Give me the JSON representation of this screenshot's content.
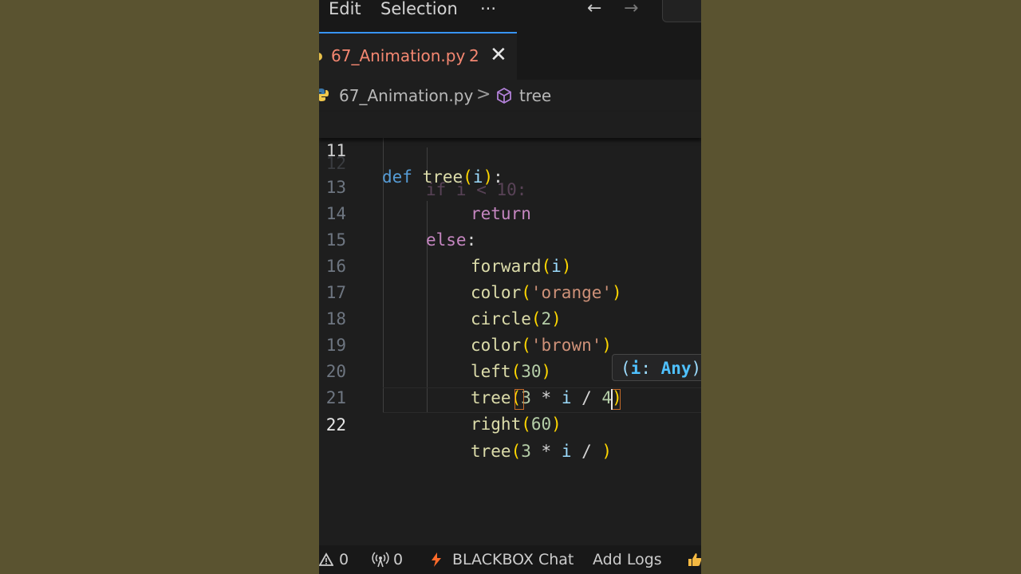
{
  "menu": {
    "edit": "Edit",
    "selection": "Selection",
    "more": "···",
    "back": "←",
    "forward": "→"
  },
  "tab": {
    "filename": "67_Animation.py",
    "problem_count": "2",
    "close": "✕"
  },
  "breadcrumb": {
    "file": "67_Animation.py",
    "separator": ">",
    "symbol": "tree"
  },
  "editor": {
    "sticky_line_number": "11",
    "sticky": {
      "def": "def",
      "name": "tree",
      "open": "(",
      "param": "i",
      "close": ")",
      "colon": ":"
    },
    "ghost_line_number": "12",
    "ghost_code": "if i < 10:",
    "lines": [
      {
        "n": "13",
        "t1": "return"
      },
      {
        "n": "14",
        "t1": "else",
        "t2": ":"
      },
      {
        "n": "15",
        "fn": "forward",
        "o": "(",
        "a": "i",
        "c": ")"
      },
      {
        "n": "16",
        "fn": "color",
        "o": "(",
        "a": "'orange'",
        "c": ")"
      },
      {
        "n": "17",
        "fn": "circle",
        "o": "(",
        "a": "2",
        "c": ")"
      },
      {
        "n": "18",
        "fn": "color",
        "o": "(",
        "a": "'brown'",
        "c": ")"
      },
      {
        "n": "19",
        "fn": "left",
        "o": "(",
        "a": "30",
        "c": ")"
      },
      {
        "n": "20",
        "fn": "tree",
        "o": "(",
        "a1": "3",
        "op1": " * ",
        "a2": "i",
        "op2": " / ",
        "a3": "4",
        "c": ")"
      },
      {
        "n": "21",
        "fn": "right",
        "o": "(",
        "a": "60",
        "c": ")"
      },
      {
        "n": "22",
        "fn": "tree",
        "o": "(",
        "a1": "3",
        "op1": " * ",
        "a2": "i",
        "op2": " / ",
        "c": ")"
      }
    ],
    "hint": {
      "open": "(",
      "param": "i",
      "sep": ": ",
      "type": "Any",
      "close": ")"
    }
  },
  "statusbar": {
    "errors": "0",
    "ports": "0",
    "blackbox": "BLACKBOX Chat",
    "add_logs": "Add Logs"
  },
  "colors": {
    "accent": "#3794ff",
    "tab_text": "#f48771",
    "keyword": "#569cd6",
    "control": "#c586c0",
    "function": "#dcdcaa",
    "string": "#ce9178",
    "number": "#b5cea8"
  }
}
